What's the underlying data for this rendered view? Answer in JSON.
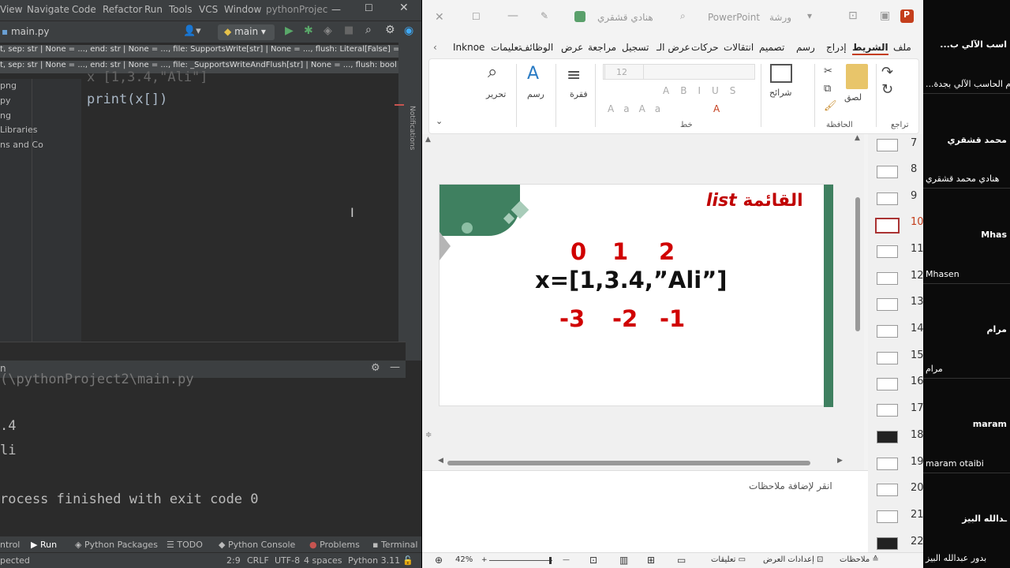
{
  "ide": {
    "menu": [
      "View",
      "Navigate",
      "Code",
      "Refactor",
      "Run",
      "Tools",
      "VCS",
      "Window",
      "pythonProjec"
    ],
    "file_tab": "main.py",
    "branch": "main",
    "hint1": "t, sep: str | None = ..., end: str | None = ..., file: SupportsWrite[str] | None = ..., flush: Literal[False] = ...",
    "hint2": "t, sep: str | None = ..., end: str | None = ..., file: _SupportsWriteAndFlush[str] | None = ..., flush: bool",
    "code_line1_partial": "x [1,3.4,\"Ali\"]",
    "line_no": "2",
    "code_text": "print(x[])",
    "project_items": [
      "png",
      "py",
      "ng",
      "Libraries",
      "ns and Co"
    ],
    "run_path": "(\\pythonProject2\\main.py",
    "output": [
      ".4",
      "li",
      "rocess finished with exit code 0"
    ],
    "bottom_tabs": [
      "ntrol",
      "Run",
      "Python Packages",
      "TODO",
      "Python Console",
      "Problems",
      "Terminal"
    ],
    "status": {
      "left": "pected",
      "pos": "2:9",
      "eol": "CRLF",
      "enc": "UTF-8",
      "indent": "4 spaces",
      "interp": "Python 3.11"
    },
    "side_label": "Notifications"
  },
  "ppt": {
    "title": "هنادي قشقري",
    "app": "PowerPoint",
    "file": "ورشة",
    "tabs": [
      "ملف",
      "الشريط",
      "إدراج",
      "رسم",
      "تصميم",
      "انتقالات",
      "حركات",
      "عرض الـ",
      "تسجيل",
      "مراجعة",
      "عرض",
      "الوظائف",
      "تعليمات",
      "Inknoe"
    ],
    "active_tab": "الشريط",
    "ribbon": {
      "undo_group": "تراجع",
      "clipboard": "الحافظة",
      "paste": "لصق",
      "slides": "شرائح",
      "font": "خط",
      "font_size": "12",
      "paragraph": "فقرة",
      "draw": "رسم",
      "edit": "تحرير"
    },
    "slide": {
      "title_ar": "القائمة",
      "title_en": "list",
      "pos_idx": [
        "0",
        "1",
        "2"
      ],
      "code": "x=[1,3.4,”Ali”]",
      "neg_idx": [
        "-3",
        "-2",
        "-1"
      ]
    },
    "thumb_numbers": [
      "7",
      "8",
      "9",
      "10",
      "11",
      "12",
      "13",
      "14",
      "15",
      "16",
      "17",
      "18",
      "19",
      "20",
      "21",
      "22"
    ],
    "active_slide": "10",
    "notes_placeholder": "انقر لإضافة ملاحظات",
    "zoom": "42%",
    "status": {
      "notes": "ملاحظات",
      "settings": "إعدادات العرض",
      "comments": "تعليقات"
    }
  },
  "participants": {
    "names": [
      "...اسب الآلي ب",
      "محمد قشقري",
      "Mhas",
      "مرام",
      "maram",
      "ـدالله البيز"
    ],
    "labels": [
      "...م الحاسب الآلي بجدة",
      "هنادي محمد قشقري",
      "Mhasen",
      "مرام",
      "maram otaibi",
      "بدور عبدالله البيز"
    ]
  }
}
